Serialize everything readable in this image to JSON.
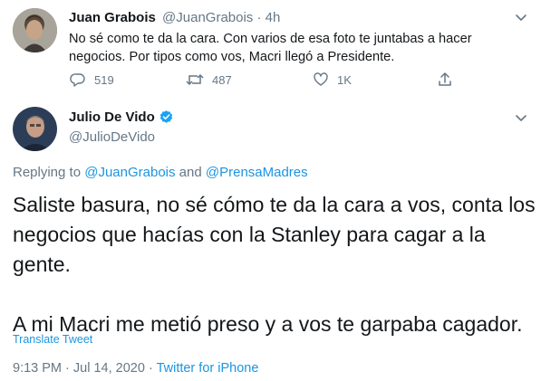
{
  "reply_tweet": {
    "display_name": "Juan Grabois",
    "handle": "@JuanGrabois",
    "separator": "·",
    "time": "4h",
    "text_line1": "No sé como te da la cara. Con varios de esa foto te juntabas a hacer",
    "text_line2": "negocios. Por tipos como vos, Macri llegó a Presidente.",
    "reply_count": "519",
    "retweet_count": "487",
    "like_count": "1K",
    "icons": [
      "reply-icon",
      "retweet-icon",
      "like-icon",
      "share-icon",
      "chevron-down-icon"
    ]
  },
  "main_tweet": {
    "display_name": "Julio De Vido",
    "handle": "@JulioDeVido",
    "verified": true,
    "replying_prefix": "Replying to",
    "replying_user1": "@JuanGrabois",
    "replying_and": "and",
    "replying_user2": "@PrensaMadres",
    "body_line1": "Saliste basura, no sé cómo te da la cara a vos, conta los",
    "body_line2": "negocios que hacías con la Stanley para cagar a la",
    "body_line3": "gente.",
    "body_line4": "A mi Macri me metió preso y a vos te garpaba cagador.",
    "translate_label": "Translate Tweet",
    "timestamp": "9:13 PM · Jul 14, 2020",
    "dot": "·",
    "source": "Twitter for iPhone"
  },
  "colors": {
    "link": "#1b95e0",
    "muted": "#657786",
    "verified": "#1da1f2",
    "text": "#14171a"
  }
}
